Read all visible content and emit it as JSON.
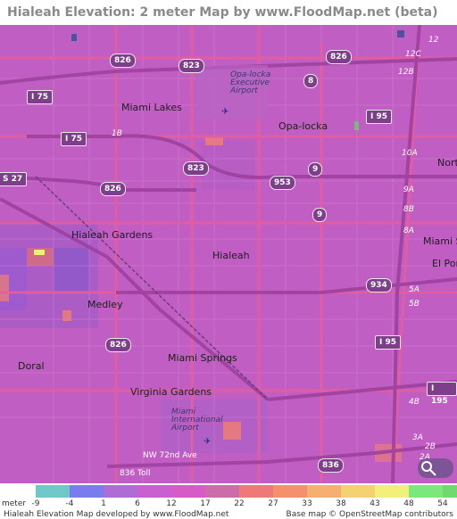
{
  "title": "Hialeah Elevation: 2 meter Map by www.FloodMap.net (beta)",
  "places": {
    "miami_lakes": "Miami Lakes",
    "opa_locka": "Opa-locka",
    "opa_locka_airport": "Opa-locka Executive Airport",
    "hialeah_gardens": "Hialeah Gardens",
    "hialeah": "Hialeah",
    "medley": "Medley",
    "doral": "Doral",
    "miami_springs": "Miami Springs",
    "virginia_gardens": "Virginia Gardens",
    "miami_intl_airport": "Miami International Airport",
    "miami_shores": "Miami Sh",
    "el_portal": "El Por",
    "north": "Nort",
    "nw_72nd_ave": "NW 72nd Ave",
    "toll_836": "836 Toll"
  },
  "shields": {
    "i75_top": "I 75",
    "i75_mid": "I 75",
    "s27": "S 27",
    "r826_top": "826",
    "r823_top": "823",
    "r826_right": "826",
    "r823_mid": "823",
    "r826_mid": "826",
    "r953": "953",
    "r9_a": "9",
    "r9_b": "9",
    "r934": "934",
    "r826_low": "826",
    "r836": "836",
    "i95_top": "I 95",
    "i95_mid": "I 95",
    "i195": "I 195",
    "r8": "8"
  },
  "exits": [
    "12",
    "12C",
    "12B",
    "10A",
    "9A",
    "8B",
    "8A",
    "5A",
    "5B",
    "4B",
    "3A",
    "2A",
    "1B",
    "2B"
  ],
  "legend": {
    "unit_label": "meter",
    "ticks": [
      "-9",
      "-4",
      "1",
      "6",
      "12",
      "17",
      "22",
      "27",
      "33",
      "38",
      "43",
      "48",
      "54"
    ],
    "colors": [
      "#6ec8c8",
      "#7b7bf0",
      "#b06cd6",
      "#c95fd0",
      "#d65bc6",
      "#cc6ca8",
      "#f07878",
      "#f5906f",
      "#f5b070",
      "#f5d070",
      "#f2f07a",
      "#7ae87a",
      "#70d870"
    ]
  },
  "footer": {
    "left": "Hialeah Elevation Map developed by www.FloodMap.net",
    "right": "Base map © OpenStreetMap contributors"
  }
}
